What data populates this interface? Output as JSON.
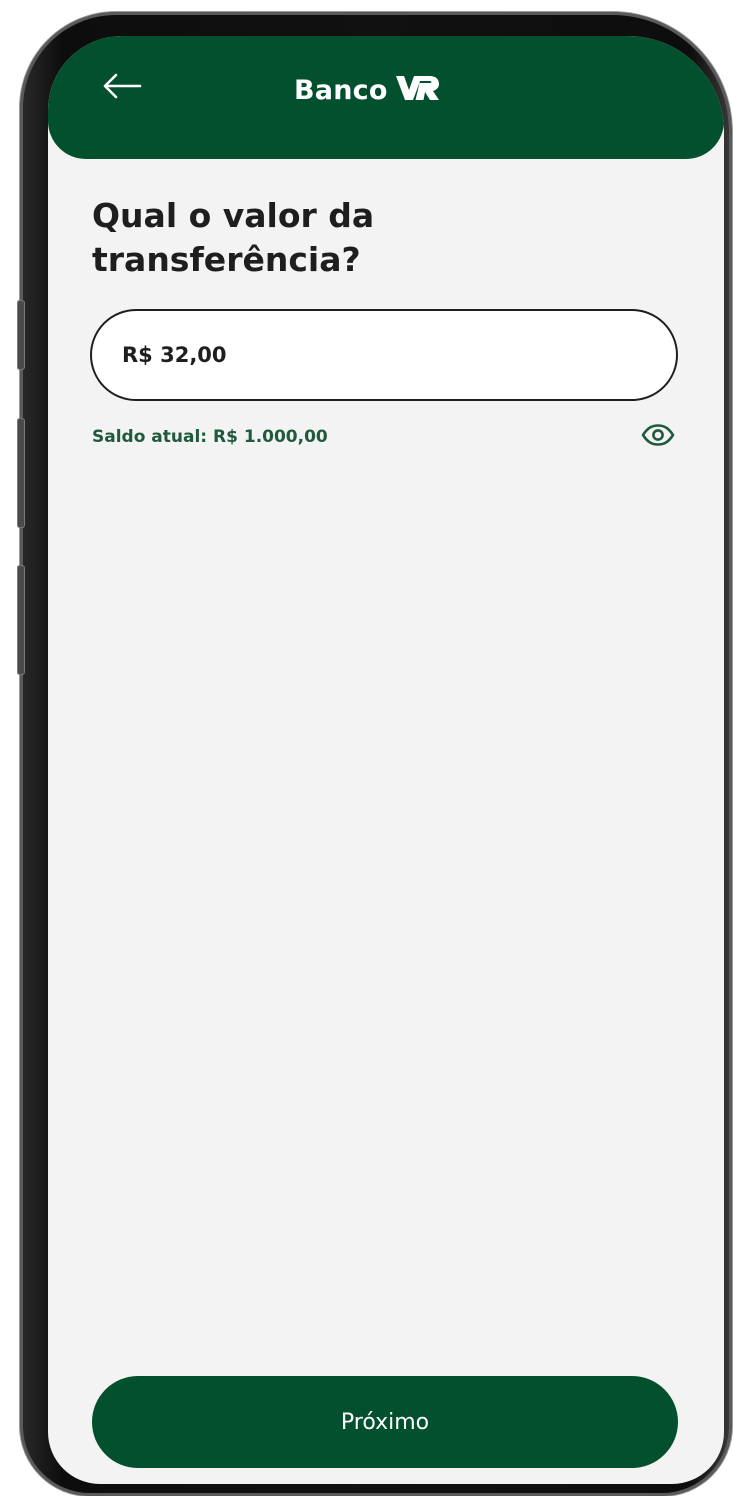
{
  "header": {
    "title": "Banco",
    "logo_text": "VR",
    "back_icon": "arrow-left-icon",
    "background_color": "#02502e"
  },
  "main": {
    "question": "Qual o valor da transferência?",
    "amount_value": "R$ 32,00",
    "balance_text": "Saldo atual: R$ 1.000,00",
    "balance_visibility_icon": "eye-icon"
  },
  "footer": {
    "next_label": "Próximo"
  },
  "colors": {
    "brand_green": "#02502e",
    "background": "#f3f3f3",
    "balance_text": "#1f5a3c"
  }
}
